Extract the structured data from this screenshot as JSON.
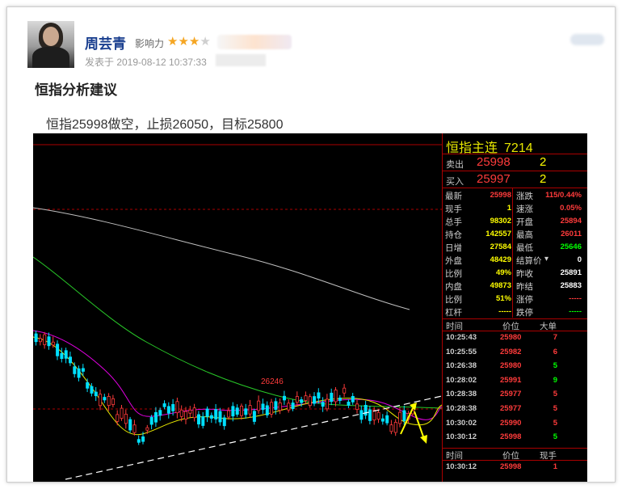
{
  "post": {
    "author": "周芸青",
    "influence_label": "影响力",
    "stars_filled": 3,
    "stars_total": 4,
    "posted_at": "发表于 2019-08-12 10:37:33",
    "title": "恒指分析建议",
    "advice": "恒指25998做空，止损26050，目标25800"
  },
  "chart": {
    "peak_label": "26246",
    "colors": {
      "up": "#ff3b3b",
      "down": "#00e0ff",
      "ma_white": "#bfbfbf",
      "ma_green": "#28c828",
      "ma_magenta": "#e000e0",
      "ma_yellow": "#e6e600",
      "trend": "#ffffff",
      "arrow": "#ffff00"
    }
  },
  "panel": {
    "name": "恒指主连",
    "code": "7214",
    "ask": {
      "label": "卖出",
      "price": "25998",
      "vol": "2"
    },
    "bid": {
      "label": "买入",
      "price": "25997",
      "vol": "2"
    },
    "quote": [
      {
        "l1": "最新",
        "v1": "25998",
        "c1": "#ff3b3b",
        "l2": "涨跌",
        "v2": "115/0.44%",
        "c2": "#ff3b3b"
      },
      {
        "l1": "现手",
        "v1": "1",
        "c1": "#ffff00",
        "l2": "速涨",
        "v2": "0.05%",
        "c2": "#ff3b3b"
      },
      {
        "l1": "总手",
        "v1": "98302",
        "c1": "#ffff00",
        "l2": "开盘",
        "v2": "25894",
        "c2": "#ff3b3b"
      },
      {
        "l1": "持仓",
        "v1": "142557",
        "c1": "#ffff00",
        "l2": "最高",
        "v2": "26011",
        "c2": "#ff3b3b"
      },
      {
        "l1": "日增",
        "v1": "27584",
        "c1": "#ffff00",
        "l2": "最低",
        "v2": "25646",
        "c2": "#00ff00"
      },
      {
        "l1": "外盘",
        "v1": "48429",
        "c1": "#ffff00",
        "l2": "结算价",
        "v2": "0",
        "c2": "#ffffff"
      },
      {
        "l1": "比例",
        "v1": "49%",
        "c1": "#ffff00",
        "l2": "昨收",
        "v2": "25891",
        "c2": "#ffffff"
      },
      {
        "l1": "内盘",
        "v1": "49873",
        "c1": "#ffff00",
        "l2": "昨结",
        "v2": "25883",
        "c2": "#ffffff"
      },
      {
        "l1": "比例",
        "v1": "51%",
        "c1": "#ffff00",
        "l2": "涨停",
        "v2": "-----",
        "c2": "#ff3b3b"
      },
      {
        "l1": "杠杆",
        "v1": "-----",
        "c1": "#ffff00",
        "l2": "跌停",
        "v2": "-----",
        "c2": "#00ff00"
      }
    ],
    "ticks_header": {
      "time": "时间",
      "price": "价位",
      "vol": "大单"
    },
    "ticks": [
      {
        "time": "10:25:43",
        "price": "25980",
        "vol": "7",
        "color": "#ff3b3b"
      },
      {
        "time": "10:25:55",
        "price": "25982",
        "vol": "6",
        "color": "#ff3b3b"
      },
      {
        "time": "10:26:38",
        "price": "25980",
        "vol": "5",
        "color": "#00ff00"
      },
      {
        "time": "10:28:02",
        "price": "25991",
        "vol": "9",
        "color": "#00ff00"
      },
      {
        "time": "10:28:38",
        "price": "25977",
        "vol": "5",
        "color": "#ff3b3b"
      },
      {
        "time": "10:28:38",
        "price": "25977",
        "vol": "5",
        "color": "#ff3b3b"
      },
      {
        "time": "10:30:02",
        "price": "25990",
        "vol": "5",
        "color": "#ff3b3b"
      },
      {
        "time": "10:30:12",
        "price": "25998",
        "vol": "5",
        "color": "#00ff00"
      }
    ],
    "ticks2_header": {
      "time": "时间",
      "price": "价位",
      "vol": "现手"
    },
    "ticks2": [
      {
        "time": "10:30:12",
        "price": "25998",
        "vol": "1",
        "color": "#ff3b3b"
      }
    ]
  }
}
